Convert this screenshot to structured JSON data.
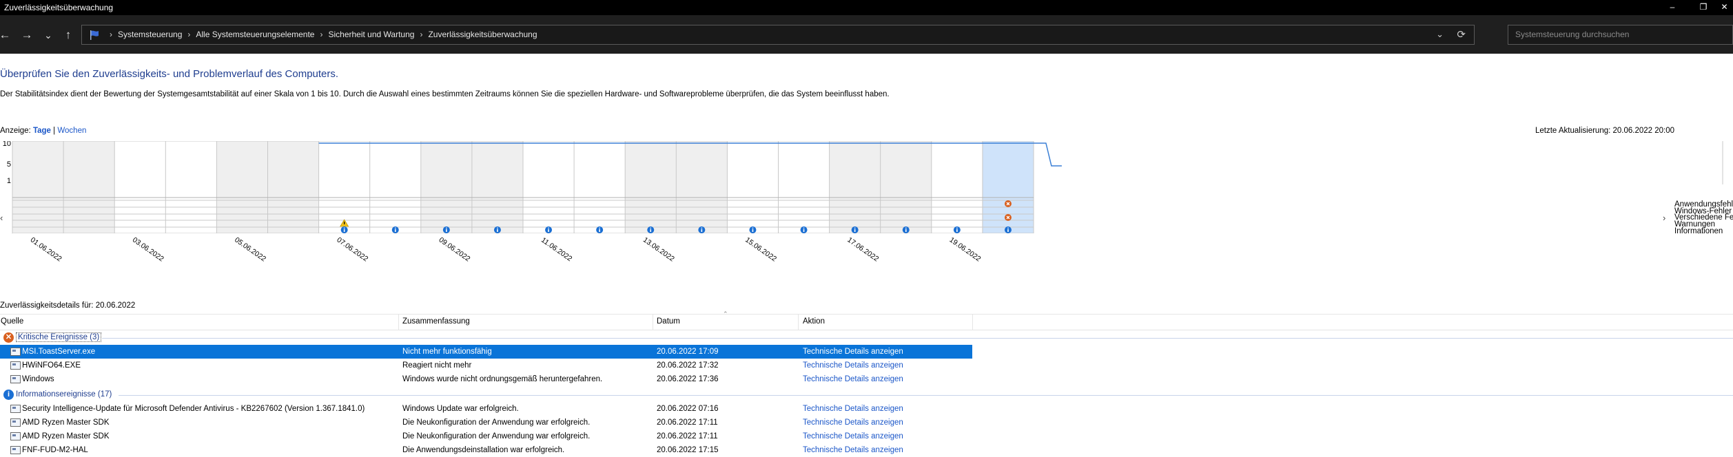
{
  "window": {
    "title": "Zuverlässigkeitsüberwachung",
    "controls": {
      "minimize": "–",
      "maximize": "❐",
      "close": "✕"
    }
  },
  "navigation": {
    "back": "←",
    "forward": "→",
    "history": "⌄",
    "up": "↑",
    "breadcrumbs": [
      "Systemsteuerung",
      "Alle Systemsteuerungselemente",
      "Sicherheit und Wartung",
      "Zuverlässigkeitsüberwachung"
    ],
    "separator": "›",
    "dropdown": "⌄",
    "refresh": "⟳",
    "search_placeholder": "Systemsteuerung durchsuchen"
  },
  "page": {
    "headline": "Überprüfen Sie den Zuverlässigkeits- und Problemverlauf des Computers.",
    "description": "Der Stabilitätsindex dient der Bewertung der Systemgesamtstabilität auf einer Skala von 1 bis 10. Durch die Auswahl eines bestimmten Zeitraums können Sie die speziellen Hardware- und Softwareprobleme überprüfen, die das System beeinflusst haben.",
    "view_label": "Anzeige:",
    "view_days": "Tage",
    "view_sep": "|",
    "view_weeks": "Wochen",
    "last_update": "Letzte Aktualisierung: 20.06.2022 20:00"
  },
  "chart_data": {
    "type": "line",
    "y_ticks": [
      "10",
      "5",
      "1"
    ],
    "ylim": [
      1,
      10
    ],
    "dates": [
      "01.06.2022",
      "02.06.2022",
      "03.06.2022",
      "04.06.2022",
      "05.06.2022",
      "06.06.2022",
      "07.06.2022",
      "08.06.2022",
      "09.06.2022",
      "10.06.2022",
      "11.06.2022",
      "12.06.2022",
      "13.06.2022",
      "14.06.2022",
      "15.06.2022",
      "16.06.2022",
      "17.06.2022",
      "18.06.2022",
      "19.06.2022",
      "20.06.2022"
    ],
    "x_tick_labels": [
      "01.06.2022",
      "03.06.2022",
      "05.06.2022",
      "07.06.2022",
      "09.06.2022",
      "11.06.2022",
      "13.06.2022",
      "15.06.2022",
      "17.06.2022",
      "19.06.2022"
    ],
    "stability_index": [
      null,
      null,
      null,
      null,
      null,
      null,
      10,
      10,
      10,
      10,
      10,
      10,
      10,
      10,
      10,
      10,
      10,
      10,
      10,
      4.5
    ],
    "selected_date": "20.06.2022",
    "rows": [
      "Anwendungsfehler",
      "Windows-Fehler",
      "Verschiedene Fehler",
      "Warnungen",
      "Informationen"
    ],
    "events": {
      "Anwendungsfehler": [
        20
      ],
      "Windows-Fehler": [],
      "Verschiedene Fehler": [
        20
      ],
      "Warnungen": [
        7
      ],
      "Informationen": [
        7,
        8,
        9,
        10,
        11,
        12,
        13,
        14,
        15,
        16,
        17,
        18,
        19,
        20
      ]
    }
  },
  "chart_nav": {
    "left": "‹",
    "right": "›"
  },
  "details": {
    "label": "Zuverlässigkeitsdetails für: 20.06.2022",
    "columns": [
      "Quelle",
      "Zusammenfassung",
      "Datum",
      "Aktion"
    ],
    "groups": [
      {
        "label": "Kritische Ereignisse (3)",
        "icon": "critical-icon",
        "color": "#d9601f",
        "rows": [
          {
            "source": "MSI.ToastServer.exe",
            "summary": "Nicht mehr funktionsfähig",
            "date": "20.06.2022 17:09",
            "action": "Technische Details anzeigen",
            "selected": true
          },
          {
            "source": "HWiNFO64.EXE",
            "summary": "Reagiert nicht mehr",
            "date": "20.06.2022 17:32",
            "action": "Technische Details anzeigen"
          },
          {
            "source": "Windows",
            "summary": "Windows wurde nicht ordnungsgemäß heruntergefahren.",
            "date": "20.06.2022 17:36",
            "action": "Technische Details anzeigen"
          }
        ]
      },
      {
        "label": "Informationsereignisse (17)",
        "icon": "info-icon",
        "color": "#1a6fd4",
        "rows": [
          {
            "source": "Security Intelligence-Update für Microsoft Defender Antivirus - KB2267602 (Version 1.367.1841.0)",
            "summary": "Windows Update war erfolgreich.",
            "date": "20.06.2022 07:16",
            "action": "Technische Details anzeigen"
          },
          {
            "source": "AMD Ryzen Master SDK",
            "summary": "Die Neukonfiguration der Anwendung war erfolgreich.",
            "date": "20.06.2022 17:11",
            "action": "Technische Details anzeigen"
          },
          {
            "source": "AMD Ryzen Master SDK",
            "summary": "Die Neukonfiguration der Anwendung war erfolgreich.",
            "date": "20.06.2022 17:11",
            "action": "Technische Details anzeigen"
          },
          {
            "source": "FNF-FUD-M2-HAL",
            "summary": "Die Anwendungsdeinstallation war erfolgreich.",
            "date": "20.06.2022 17:15",
            "action": "Technische Details anzeigen"
          }
        ]
      }
    ]
  }
}
